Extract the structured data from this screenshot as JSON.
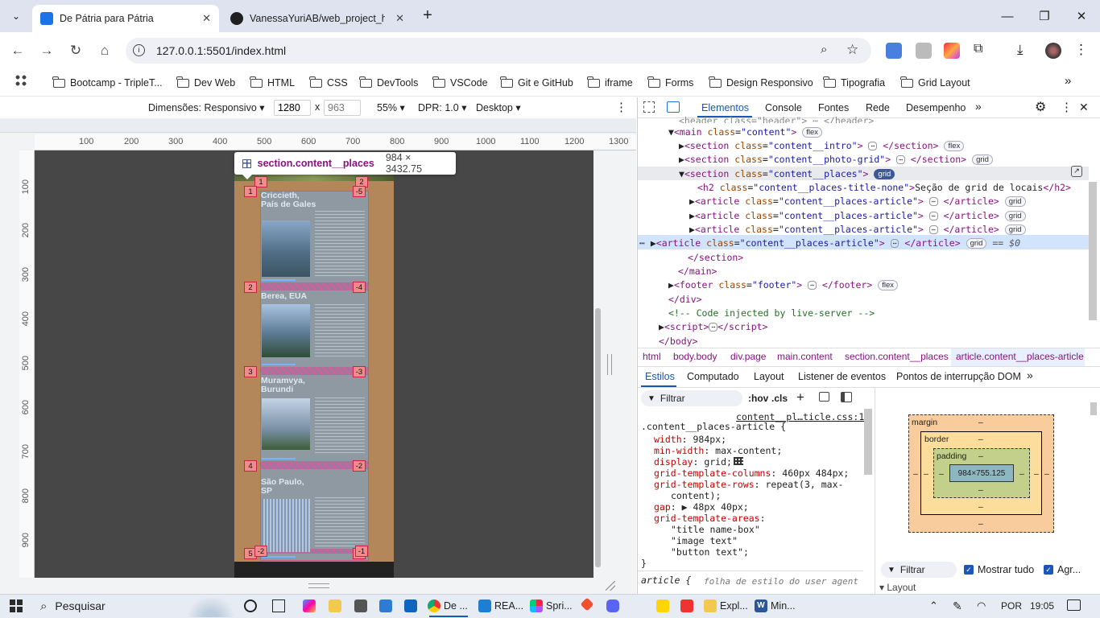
{
  "browser": {
    "tabs": [
      {
        "title": "De Pátria para Pátria",
        "active": true
      },
      {
        "title": "VanessaYuriAB/web_project_ho",
        "active": false
      }
    ],
    "url": "127.0.0.1:5501/index.html",
    "bookmarks": [
      "Bootcamp - TripleT...",
      "Dev Web",
      "HTML",
      "CSS",
      "DevTools",
      "VSCode",
      "Git e GitHub",
      "iframe",
      "Forms",
      "Design Responsivo",
      "Tipografia",
      "Grid Layout"
    ]
  },
  "device_toolbar": {
    "dimensions_label": "Dimensões: Responsivo",
    "width": "1280",
    "height": "963",
    "times": "x",
    "zoom": "55%",
    "dpr": "DPR: 1.0",
    "mode": "Desktop"
  },
  "rulers": {
    "h": [
      "100",
      "200",
      "300",
      "400",
      "500",
      "600",
      "700",
      "800",
      "900",
      "1000",
      "1100",
      "1200",
      "1300"
    ],
    "v": [
      "100",
      "200",
      "300",
      "400",
      "500",
      "600",
      "700",
      "800",
      "900"
    ]
  },
  "page": {
    "tooltip_selector": "section.content__places",
    "tooltip_size": "984 × 3432.75",
    "articles": [
      {
        "title": "Criccieth, País de Gales"
      },
      {
        "title": "Berea, EUA"
      },
      {
        "title": "Muramvya, Burundi"
      },
      {
        "title": "São Paulo, SP"
      }
    ],
    "grid_left": [
      "1",
      "2",
      "3",
      "4",
      "5"
    ],
    "grid_right": [
      "-5",
      "-4",
      "-3",
      "-2",
      "-1"
    ],
    "grid_top": [
      "1",
      "2"
    ],
    "grid_bottom": [
      "-2",
      "-1"
    ]
  },
  "devtools": {
    "tabs": [
      "Elementos",
      "Console",
      "Fontes",
      "Rede",
      "Desempenho"
    ],
    "active_tab": "Elementos",
    "breadcrumbs": [
      "html",
      "body.body",
      "div.page",
      "main.content",
      "section.content__places",
      "article.content__places-article"
    ],
    "styles_tabs": [
      "Estilos",
      "Computado",
      "Layout",
      "Listener de eventos",
      "Pontos de interrupção DOM"
    ],
    "filter_placeholder": "Filtrar",
    "hov": ":hov",
    "cls": ".cls",
    "source_link": "content__pl…ticle.css:1",
    "selector": ".content__places-article {",
    "declarations": [
      {
        "prop": "width",
        "val": "984px;"
      },
      {
        "prop": "min-width",
        "val": "max-content;"
      },
      {
        "prop": "display",
        "val": "grid;"
      },
      {
        "prop": "grid-template-columns",
        "val": "460px 484px;"
      },
      {
        "prop": "grid-template-rows",
        "val": "repeat(3, max-"
      },
      {
        "prop": "",
        "val": "content);"
      },
      {
        "prop": "gap",
        "val": "▶ 48px 40px;"
      },
      {
        "prop": "grid-template-areas",
        "val": ""
      },
      {
        "prop": "",
        "val": "\"title name-box\""
      },
      {
        "prop": "",
        "val": "\"image text\""
      },
      {
        "prop": "",
        "val": "\"button text\";"
      }
    ],
    "close_brace": "}",
    "ua_selector": "article {",
    "ua_comment": "folha de estilo do user agent",
    "boxmodel": {
      "margin": "margin",
      "border": "border",
      "padding": "padding",
      "content": "984×755.125",
      "dash": "–"
    },
    "bm_filter": "Filtrar",
    "show_all": "Mostrar tudo",
    "group": "Agr...",
    "layout_section": "Layout",
    "dollar0": "== $0"
  },
  "taskbar": {
    "search": "Pesquisar",
    "items": [
      "De ...",
      "REA...",
      "Spri...",
      "Expl...",
      "Min..."
    ],
    "lang": "POR",
    "time": "19:05"
  }
}
